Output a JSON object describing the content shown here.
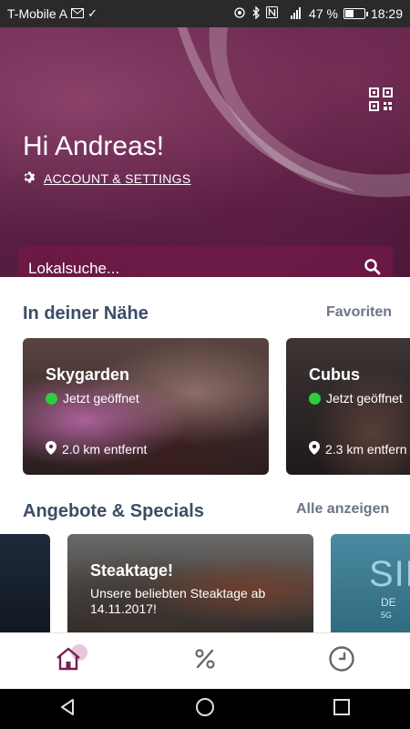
{
  "status_bar": {
    "carrier": "T-Mobile A",
    "battery_percent": "47 %",
    "battery_level": 0.47,
    "time": "18:29"
  },
  "hero": {
    "greeting": "Hi Andreas!",
    "account_label": "ACCOUNT & SETTINGS",
    "search_placeholder": "Lokalsuche..."
  },
  "nearby": {
    "title": "In deiner Nähe",
    "link": "Favoriten",
    "cards": [
      {
        "name": "Skygarden",
        "status": "Jetzt geöffnet",
        "distance": "2.0 km entfernt"
      },
      {
        "name": "Cubus",
        "status": "Jetzt geöffnet",
        "distance": "2.3 km entfern"
      }
    ]
  },
  "offers": {
    "title": "Angebote & Specials",
    "link": "Alle anzeigen",
    "items": [
      {
        "title": "Steaktage!",
        "description": "Unsere beliebten Steaktage ab 14.11.2017!"
      }
    ],
    "partial_text": "SIL",
    "partial_sub": "DE",
    "partial_small": "5G"
  },
  "bottom_nav": {
    "tabs": [
      {
        "icon": "home-icon",
        "active": true
      },
      {
        "icon": "percent-icon",
        "active": false
      },
      {
        "icon": "clock-icon",
        "active": false
      }
    ]
  },
  "colors": {
    "accent": "#7a1d55",
    "section_title": "#3d4d66",
    "open_status": "#2ecc40"
  }
}
